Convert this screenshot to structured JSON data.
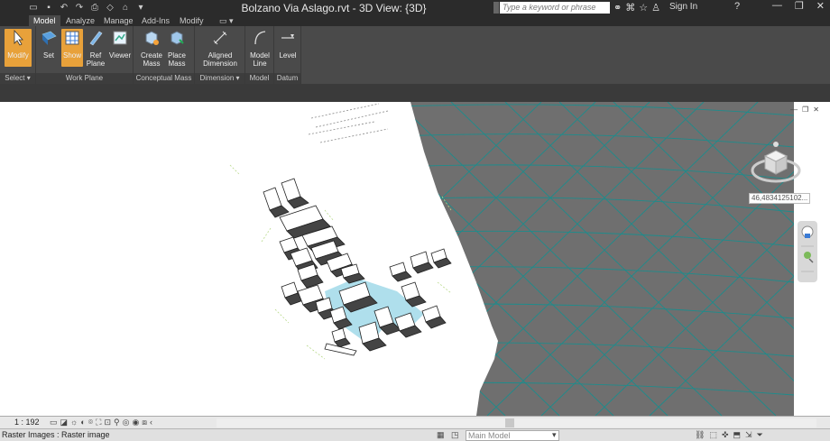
{
  "title": "Bolzano Via Aslago.rvt - 3D View: {3D}",
  "search_placeholder": "Type a keyword or phrase",
  "signin": "Sign In",
  "tabs": [
    "Model",
    "Analyze",
    "Manage",
    "Add-Ins",
    "Modify"
  ],
  "ribbon": {
    "modify": "Modify",
    "set": "Set",
    "show": "Show",
    "ref_plane": "Ref Plane",
    "viewer": "Viewer",
    "create_mass": "Create Mass",
    "place_mass": "Place Mass",
    "aligned_dimension": "Aligned Dimension",
    "model_line": "Model Line",
    "level": "Level",
    "panels": {
      "select": "Select",
      "work_plane": "Work Plane",
      "conceptual_mass": "Conceptual Mass",
      "dimension": "Dimension",
      "model": "Model",
      "datum": "Datum"
    }
  },
  "viewport": {
    "coordinate": "46,4834125102..."
  },
  "status": {
    "scale": "1 : 192",
    "message": "Raster Images : Raster image",
    "workset": "Main Model"
  },
  "colors": {
    "ribbon_bg": "#4a4a4a",
    "highlight": "#e8a13a",
    "terrain": "#6f6f6f",
    "terrain_mesh": "#1e8c8c",
    "water": "#a6dcea"
  }
}
